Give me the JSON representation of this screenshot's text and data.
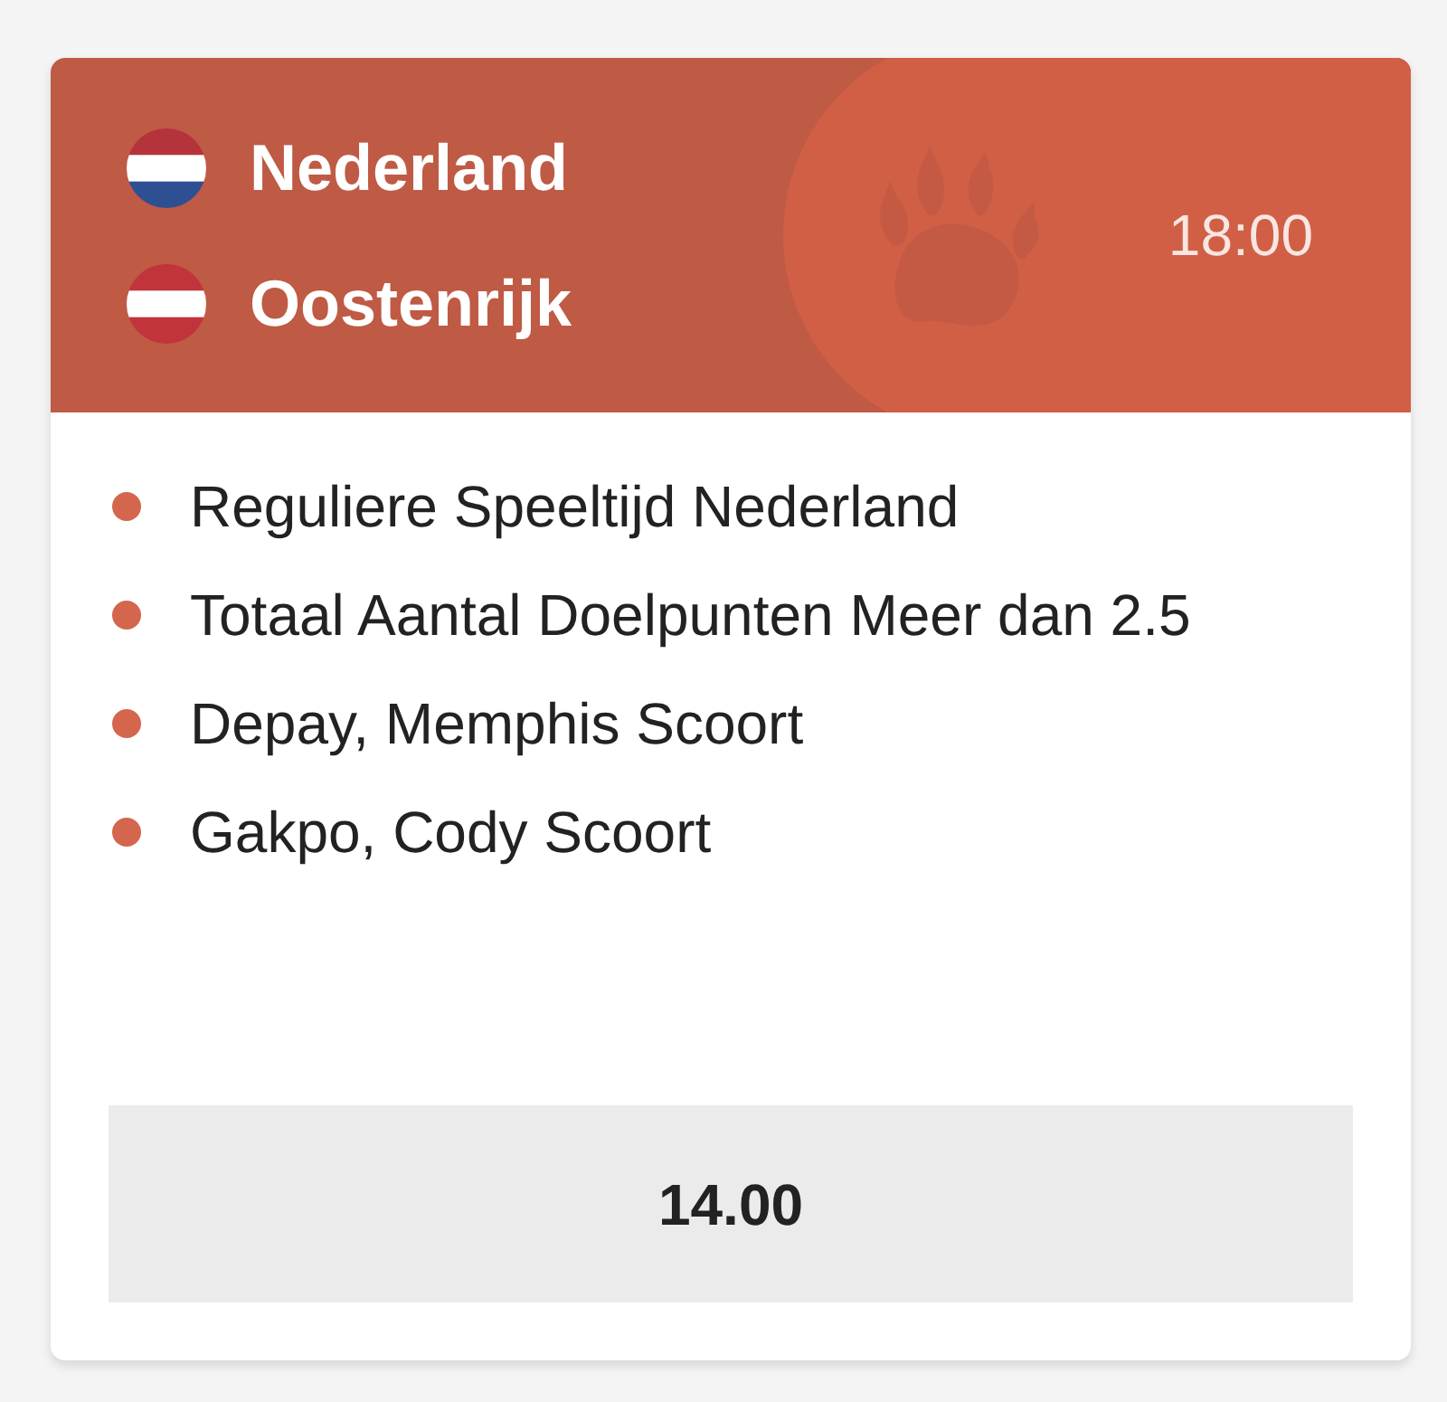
{
  "match": {
    "teams": [
      {
        "name": "Nederland",
        "kind": "netherlands"
      },
      {
        "name": "Oostenrijk",
        "kind": "austria"
      }
    ],
    "time": "18:00"
  },
  "selections": [
    {
      "label": "Reguliere Speeltijd Nederland"
    },
    {
      "label": "Totaal Aantal Doelpunten Meer dan 2.5"
    },
    {
      "label": "Depay, Memphis Scoort"
    },
    {
      "label": "Gakpo, Cody Scoort"
    }
  ],
  "odds_button": {
    "label": "14.00"
  }
}
